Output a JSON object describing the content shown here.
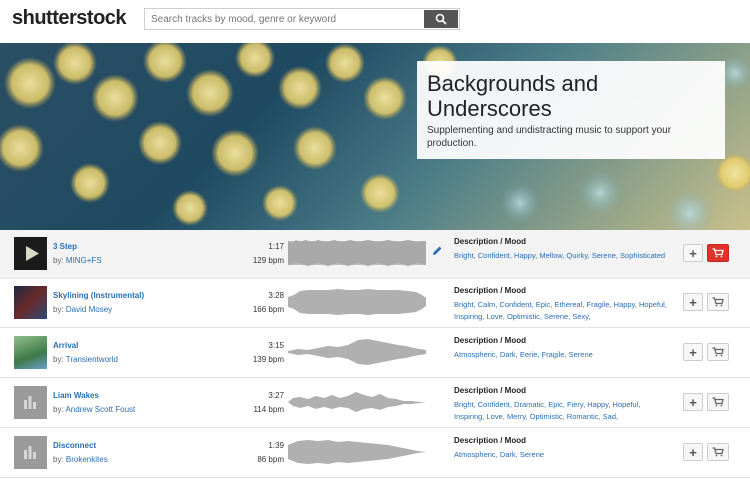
{
  "brand": {
    "logo": "shutterstock"
  },
  "search": {
    "placeholder": "Search tracks by mood, genre or keyword"
  },
  "hero": {
    "title_line1": "Backgrounds and",
    "title_line2": "Underscores",
    "subtitle": "Supplementing and undistracting music to support your production."
  },
  "desc_heading": "Description / Mood",
  "tracks": [
    {
      "title": "3 Step",
      "by": "by:",
      "artist": "MING+FS",
      "duration": "1:17",
      "bpm": "129 bpm",
      "moods": "Bright, Confident, Happy, Mellow, Quirky, Serene, Sophisticated"
    },
    {
      "title": "Skylining (Instrumental)",
      "by": "by:",
      "artist": "David Mosey",
      "duration": "3:28",
      "bpm": "166 bpm",
      "moods": "Bright, Calm, Confident, Epic, Ethereal, Fragile, Happy, Hopeful, Inspiring, Love, Optimistic, Serene, Sexy,"
    },
    {
      "title": "Arrival",
      "by": "by:",
      "artist": "Transientworld",
      "duration": "3:15",
      "bpm": "139 bpm",
      "moods": "Atmospheric, Dark, Eerie, Fragile, Serene"
    },
    {
      "title": "Liam Wakes",
      "by": "by:",
      "artist": "Andrew Scott Foust",
      "duration": "3:27",
      "bpm": "114 bpm",
      "moods": "Bright, Confident, Dramatic, Epic, Fiery, Happy, Hopeful, Inspiring, Love, Merry, Optimistic, Romantic, Sad,"
    },
    {
      "title": "Disconnect",
      "by": "by:",
      "artist": "Brokenkites",
      "duration": "1:39",
      "bpm": "86 bpm",
      "moods": "Atmospheric, Dark, Serene"
    }
  ],
  "colors": {
    "link": "#2a6fb6",
    "cart_active": "#e0322a",
    "search_button": "#555555"
  }
}
